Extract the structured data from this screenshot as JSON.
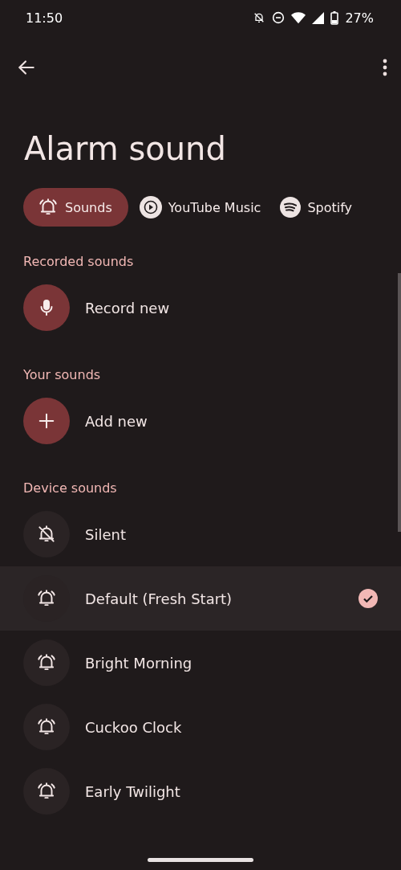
{
  "status_bar": {
    "time": "11:50",
    "battery": "27%"
  },
  "title": "Alarm sound",
  "tabs": [
    {
      "label": "Sounds",
      "kind": "sounds",
      "selected": true
    },
    {
      "label": "YouTube Music",
      "kind": "youtube",
      "selected": false
    },
    {
      "label": "Spotify",
      "kind": "spotify",
      "selected": false
    }
  ],
  "sections": [
    {
      "title": "Recorded sounds",
      "items": [
        {
          "label": "Record new",
          "kind": "record"
        }
      ]
    },
    {
      "title": "Your sounds",
      "items": [
        {
          "label": "Add new",
          "kind": "add"
        }
      ]
    },
    {
      "title": "Device sounds",
      "items": [
        {
          "label": "Silent",
          "kind": "silent",
          "selected": false
        },
        {
          "label": "Default (Fresh Start)",
          "kind": "sound",
          "selected": true
        },
        {
          "label": "Bright Morning",
          "kind": "sound",
          "selected": false
        },
        {
          "label": "Cuckoo Clock",
          "kind": "sound",
          "selected": false
        },
        {
          "label": "Early Twilight",
          "kind": "sound",
          "selected": false
        }
      ]
    }
  ]
}
